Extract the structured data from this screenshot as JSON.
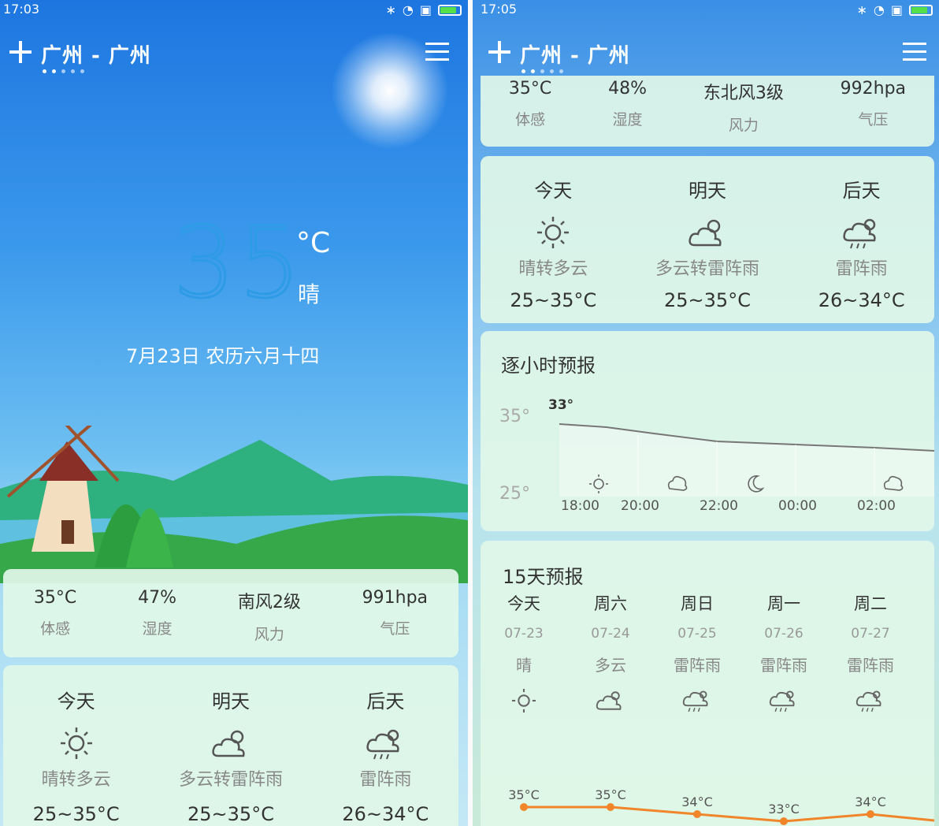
{
  "screen1": {
    "status": {
      "time": "17:03"
    },
    "header": {
      "city": "广州 - 广州"
    },
    "current": {
      "temp": "35",
      "unit": "°C",
      "condition": "晴",
      "date": "7月23日 农历六月十四"
    },
    "stats": [
      {
        "value": "35°C",
        "label": "体感"
      },
      {
        "value": "47%",
        "label": "湿度"
      },
      {
        "value": "南风2级",
        "label": "风力"
      },
      {
        "value": "991hpa",
        "label": "气压"
      }
    ],
    "days": [
      {
        "name": "今天",
        "icon": "sun-icon",
        "condition": "晴转多云",
        "range": "25~35°C"
      },
      {
        "name": "明天",
        "icon": "cloud-sun-icon",
        "condition": "多云转雷阵雨",
        "range": "25~35°C"
      },
      {
        "name": "后天",
        "icon": "thunder-rain-icon",
        "condition": "雷阵雨",
        "range": "26~34°C"
      }
    ]
  },
  "screen2": {
    "status": {
      "time": "17:05"
    },
    "header": {
      "city": "广州 - 广州"
    },
    "stats": [
      {
        "value": "35°C",
        "label": "体感"
      },
      {
        "value": "48%",
        "label": "湿度"
      },
      {
        "value": "东北风3级",
        "label": "风力"
      },
      {
        "value": "992hpa",
        "label": "气压"
      }
    ],
    "days": [
      {
        "name": "今天",
        "icon": "sun-icon",
        "condition": "晴转多云",
        "range": "25~35°C"
      },
      {
        "name": "明天",
        "icon": "cloud-sun-icon",
        "condition": "多云转雷阵雨",
        "range": "25~35°C"
      },
      {
        "name": "后天",
        "icon": "thunder-rain-icon",
        "condition": "雷阵雨",
        "range": "26~34°C"
      }
    ],
    "hourly": {
      "title": "逐小时预报",
      "y_max_label": "35°",
      "y_min_label": "25°",
      "peak_label": "33°",
      "times": [
        "18:00",
        "20:00",
        "22:00",
        "00:00",
        "02:00"
      ],
      "icons": [
        "sun-icon",
        "cloud-moon-icon",
        "moon-icon",
        "cloud-moon-icon",
        ""
      ]
    },
    "forecast15": {
      "title": "15天预报",
      "days": [
        {
          "day": "今天",
          "date": "07-23",
          "weather": "晴",
          "icon": "sun-icon",
          "high": "35°C"
        },
        {
          "day": "周六",
          "date": "07-24",
          "weather": "多云",
          "icon": "cloud-sun-icon",
          "high": "35°C"
        },
        {
          "day": "周日",
          "date": "07-25",
          "weather": "雷阵雨",
          "icon": "thunder-rain-icon",
          "high": "34°C"
        },
        {
          "day": "周一",
          "date": "07-26",
          "weather": "雷阵雨",
          "icon": "thunder-rain-icon",
          "high": "33°C"
        },
        {
          "day": "周二",
          "date": "07-27",
          "weather": "雷阵雨",
          "icon": "thunder-rain-icon",
          "high": "34°C"
        }
      ]
    }
  },
  "chart_data": {
    "type": "line",
    "categories": [
      "今天",
      "周六",
      "周日",
      "周一",
      "周二"
    ],
    "series": [
      {
        "values": [
          35,
          35,
          34,
          33,
          34
        ]
      }
    ],
    "ylabel": "",
    "xlabel": ""
  }
}
